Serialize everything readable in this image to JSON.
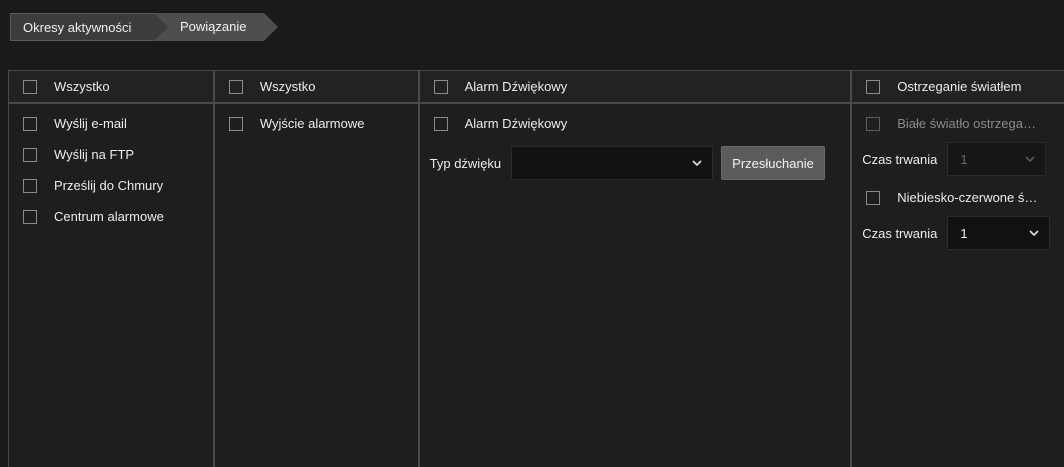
{
  "breadcrumb": {
    "items": [
      "Okresy aktywności",
      "Powiązanie"
    ]
  },
  "col1": {
    "header": "Wszystko",
    "items": [
      "Wyślij e-mail",
      "Wyślij na FTP",
      "Prześlij do Chmury",
      "Centrum alarmowe"
    ]
  },
  "col2": {
    "header": "Wszystko",
    "items": [
      "Wyjście alarmowe"
    ]
  },
  "col3": {
    "header": "Alarm Dźwiękowy",
    "item": "Alarm Dźwiękowy",
    "sound_type_label": "Typ dźwięku",
    "sound_type_value": "",
    "preview_button": "Przesłuchanie"
  },
  "col4": {
    "header": "Ostrzeganie światłem",
    "white_light_label": "Białe światło ostrzega…",
    "duration_label_1": "Czas trwania",
    "duration_value_1": "1",
    "redblue_label": "Niebiesko-czerwone ś…",
    "duration_label_2": "Czas trwania",
    "duration_value_2": "1"
  },
  "colors": {
    "background": "#1a1a1a",
    "border": "#4a4a4a",
    "tab_active": "#4e4e4e",
    "button": "#5b5b5b"
  }
}
